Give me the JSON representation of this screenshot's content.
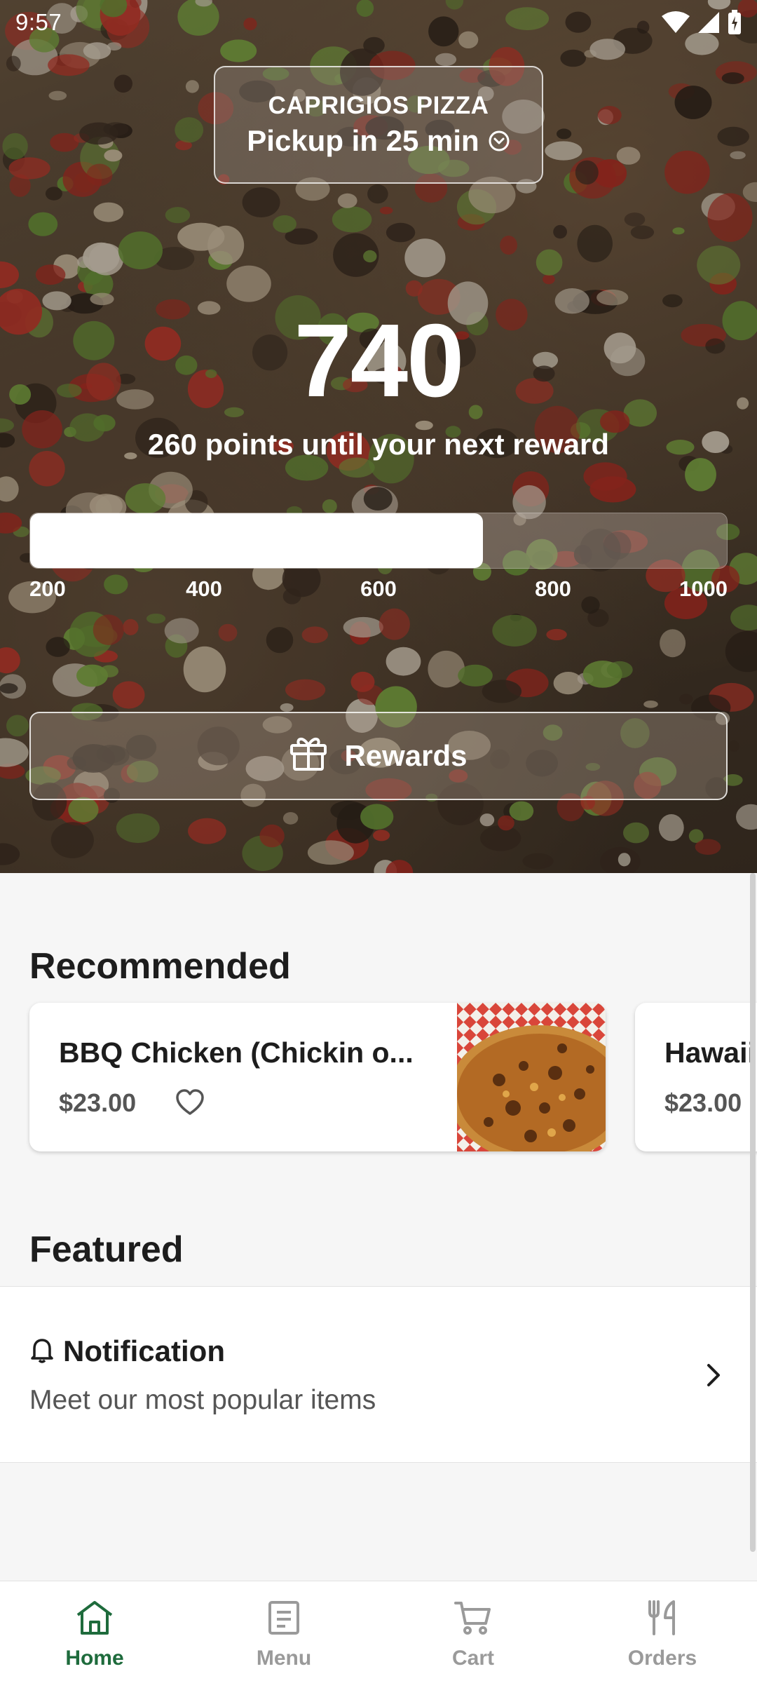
{
  "status_bar": {
    "time": "9:57"
  },
  "store": {
    "name": "CAPRIGIOS PIZZA",
    "pickup": "Pickup in 25 min"
  },
  "rewards": {
    "points": "740",
    "caption": "260 points until your next reward",
    "progress_fraction": 0.65,
    "ticks": [
      "200",
      "400",
      "600",
      "800",
      "1000"
    ],
    "button_label": "Rewards"
  },
  "recommended": {
    "title": "Recommended",
    "items": [
      {
        "name": "BBQ Chicken (Chickin o...",
        "price": "$23.00"
      },
      {
        "name": "Hawaii",
        "price": "$23.00"
      }
    ]
  },
  "featured": {
    "title": "Featured",
    "notification_title": "Notification",
    "notification_subtitle": "Meet our most popular items"
  },
  "nav": {
    "items": [
      {
        "label": "Home",
        "icon": "home-icon"
      },
      {
        "label": "Menu",
        "icon": "menu-icon"
      },
      {
        "label": "Cart",
        "icon": "cart-icon"
      },
      {
        "label": "Orders",
        "icon": "orders-icon"
      }
    ],
    "active": "Home"
  },
  "colors": {
    "accent": "#1e6b3c",
    "inactive": "#9a9a9a"
  }
}
